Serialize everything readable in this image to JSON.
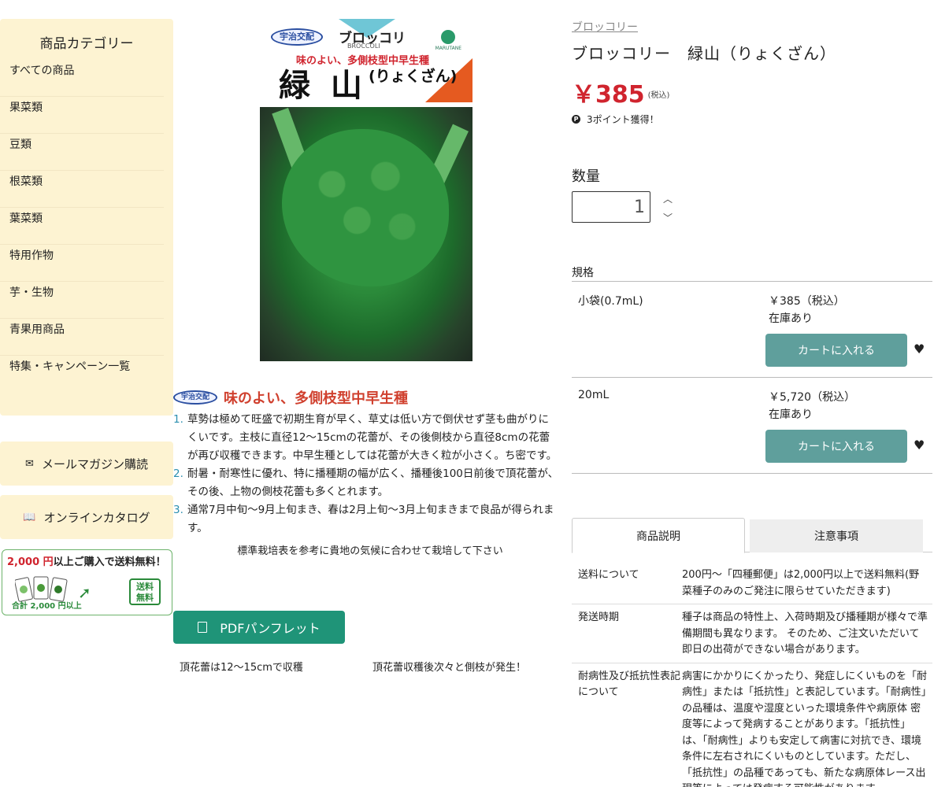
{
  "sidebar": {
    "title": "商品カテゴリー",
    "items": [
      {
        "label": "すべての商品"
      },
      {
        "label": "果菜類"
      },
      {
        "label": "豆類"
      },
      {
        "label": "根菜類"
      },
      {
        "label": "葉菜類"
      },
      {
        "label": "特用作物"
      },
      {
        "label": "芋・生物"
      },
      {
        "label": "青果用商品"
      },
      {
        "label": "特集・キャンペーン一覧"
      }
    ],
    "newsletter_label": "メールマガジン購読",
    "catalog_label": "オンラインカタログ",
    "promo": {
      "amount": "2,000 円",
      "text": "以上ご購入で送料無料！",
      "sub": "合計 2,000 円以上",
      "free_line1": "送料",
      "free_line2": "無料"
    }
  },
  "package": {
    "badge": "宇治交配",
    "brand": "ブロッコリ",
    "brand_en": "BROCCOLI",
    "maker": "MARUTANE",
    "tagline": "味のよい、多側枝型中早生種",
    "name": "緑 山",
    "reading": "(りょくざん)"
  },
  "description": {
    "badge": "宇治交配",
    "headline": "味のよい、多側枝型中早生種",
    "points": [
      {
        "num": "1.",
        "text": "草勢は極めて旺盛で初期生育が早く、草丈は低い方で倒伏せず茎も曲がりにくいです。主枝に直径12〜15cmの花蕾が、その後側枝から直径8cmの花蕾が再び収穫できます。中早生種としては花蕾が大きく粒が小さく。ち密です。"
      },
      {
        "num": "2.",
        "text": "耐暑・耐寒性に優れ、特に播種期の幅が広く、播種後100日前後で頂花蕾が、その後、上物の側枝花蕾も多くとれます。"
      },
      {
        "num": "3.",
        "text": "通常7月中旬〜9月上旬まき、春は2月上旬〜3月上旬まきまで良品が得られます。"
      }
    ],
    "note": "標準栽培表を参考に貴地の気候に合わせて栽培して下さい",
    "pdf_label": "PDFパンフレット",
    "caption_left": "頂花蕾は12〜15cmで収穫",
    "caption_right": "頂花蕾収穫後次々と側枝が発生！"
  },
  "product": {
    "breadcrumb": "ブロッコリー",
    "title": "ブロッコリー　緑山（りょくざん）",
    "price": "￥385",
    "tax": "(税込)",
    "points_text": "3ポイント獲得！",
    "quantity_label": "数量",
    "quantity": "1",
    "spec_label": "規格",
    "specs": [
      {
        "size": "小袋(0.7mL)",
        "price": "￥385（税込）",
        "stock": "在庫あり",
        "cart": "カートに入れる"
      },
      {
        "size": "20mL",
        "price": "￥5,720（税込）",
        "stock": "在庫あり",
        "cart": "カートに入れる"
      }
    ]
  },
  "tabs": [
    {
      "label": "商品説明"
    },
    {
      "label": "注意事項"
    }
  ],
  "info": [
    {
      "key": "送料について",
      "value": "200円〜「四種郵便」は2,000円以上で送料無料(野菜種子のみのご発注に限らせていただきます)"
    },
    {
      "key": "発送時期",
      "value": "種子は商品の特性上、入荷時期及び播種期が様々で準備期間も異なります。 そのため、ご注文いただいて即日の出荷ができない場合があります。"
    },
    {
      "key": "耐病性及び抵抗性表記について",
      "value": "病害にかかりにくかったり、発症しにくいものを「耐病性」または「抵抗性」と表記しています。「耐病性」の品種は、温度や湿度といった環境条件や病原体 密度等によって発病することがあります。「抵抗性」は、「耐病性」よりも安定して病害に対抗でき、環境条件に左右されにくいものとしています。ただし、「抵抗性」の品種であっても、新たな病原体レース出現等によっては発病する可能性があります。"
    }
  ],
  "colors": {
    "sidebar_bg": "#fdf3d2",
    "price_red": "#d0242e",
    "cart_teal": "#5f9f9c",
    "pdf_green": "#1f9478"
  }
}
